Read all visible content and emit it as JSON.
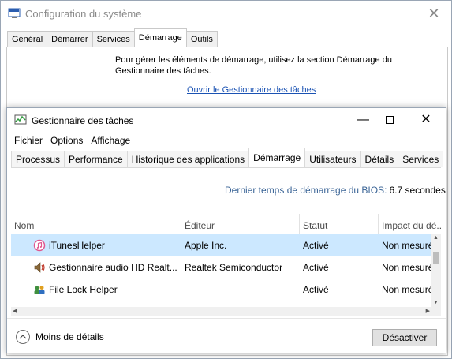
{
  "msconfig": {
    "title": "Configuration du système",
    "tabs": [
      "Général",
      "Démarrer",
      "Services",
      "Démarrage",
      "Outils"
    ],
    "active_tab": "Démarrage",
    "info_line1": "Pour gérer les éléments de démarrage, utilisez la section Démarrage du",
    "info_line2": "Gestionnaire des tâches.",
    "link": "Ouvrir le Gestionnaire des tâches"
  },
  "taskmgr": {
    "title": "Gestionnaire des tâches",
    "menus": [
      "Fichier",
      "Options",
      "Affichage"
    ],
    "tabs": [
      "Processus",
      "Performance",
      "Historique des applications",
      "Démarrage",
      "Utilisateurs",
      "Détails",
      "Services"
    ],
    "active_tab": "Démarrage",
    "bios_label": "Dernier temps de démarrage du BIOS:",
    "bios_value": "6.7 secondes",
    "columns": [
      "Nom",
      "Éditeur",
      "Statut",
      "Impact du dé..."
    ],
    "rows": [
      {
        "name": "iTunesHelper",
        "publisher": "Apple Inc.",
        "status": "Activé",
        "impact": "Non mesuré",
        "icon": "itunes-icon"
      },
      {
        "name": "Gestionnaire audio HD Realt...",
        "publisher": "Realtek Semiconductor",
        "status": "Activé",
        "impact": "Non mesuré",
        "icon": "speaker-icon"
      },
      {
        "name": "File Lock Helper",
        "publisher": "",
        "status": "Activé",
        "impact": "Non mesuré",
        "icon": "users-icon"
      }
    ],
    "fewer_details": "Moins de détails",
    "disable_button": "Désactiver"
  },
  "colors": {
    "selection": "#cce8ff",
    "link": "#1a52b3",
    "bios_label": "#3a6496"
  }
}
